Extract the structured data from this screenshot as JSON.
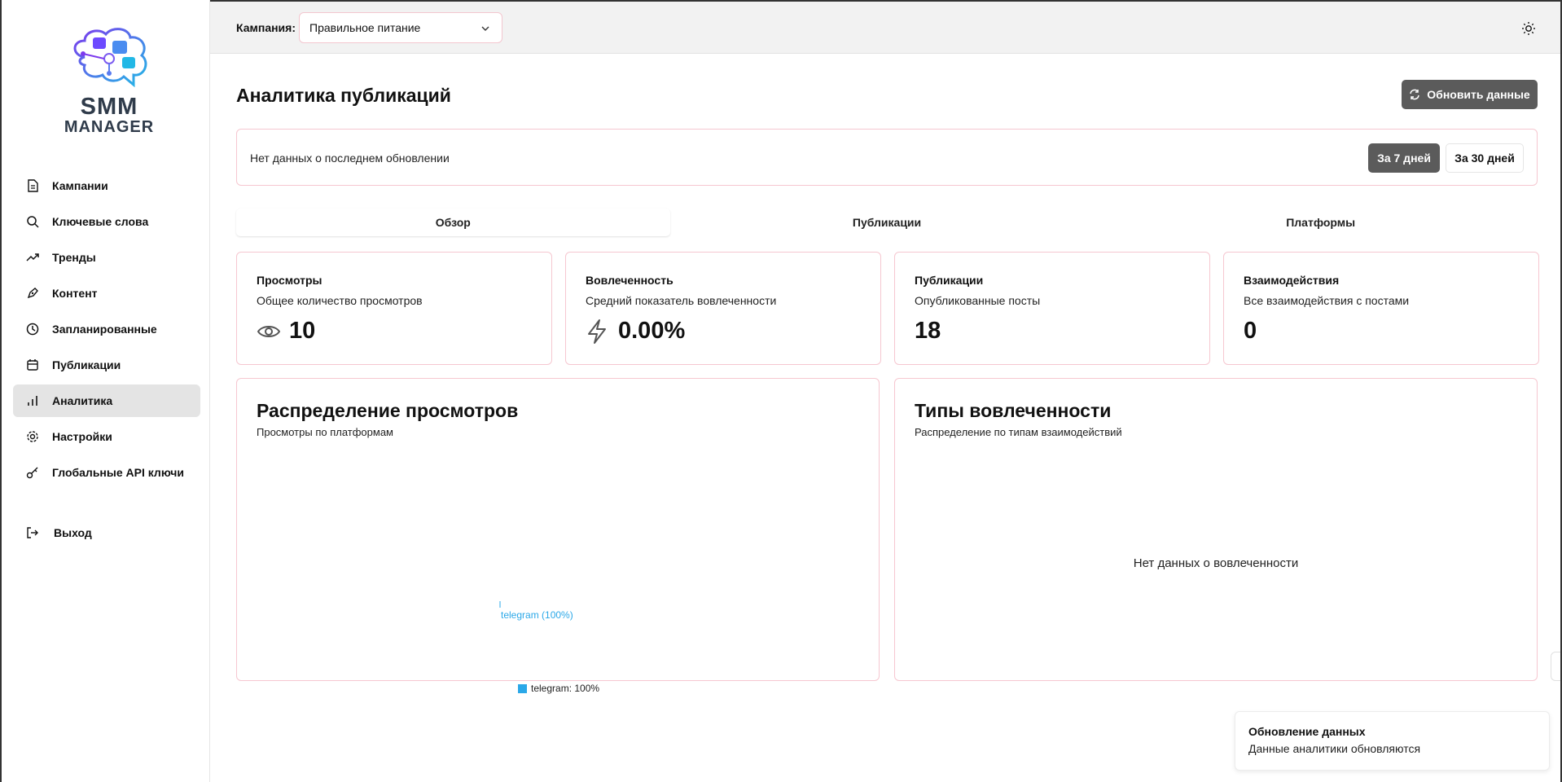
{
  "brand": {
    "line1": "SMM",
    "line2": "MANAGER"
  },
  "sidebar": {
    "items": [
      {
        "label": "Кампании",
        "icon": "file-icon"
      },
      {
        "label": "Ключевые слова",
        "icon": "search-icon"
      },
      {
        "label": "Тренды",
        "icon": "trending-icon"
      },
      {
        "label": "Контент",
        "icon": "pen-icon"
      },
      {
        "label": "Запланированные",
        "icon": "clock-icon"
      },
      {
        "label": "Публикации",
        "icon": "calendar-icon"
      },
      {
        "label": "Аналитика",
        "icon": "bar-chart-icon",
        "active": true
      },
      {
        "label": "Настройки",
        "icon": "gear-icon"
      },
      {
        "label": "Глобальные API ключи",
        "icon": "key-icon"
      }
    ],
    "logout": "Выход"
  },
  "header": {
    "campaign_label": "Кампания:",
    "campaign_value": "Правильное питание"
  },
  "page": {
    "title": "Аналитика публикаций",
    "refresh_label": "Обновить данные",
    "status_text": "Нет данных о последнем обновлении",
    "range_7": "За 7 дней",
    "range_30": "За 30 дней"
  },
  "tabs": [
    {
      "label": "Обзор",
      "active": true
    },
    {
      "label": "Публикации"
    },
    {
      "label": "Платформы"
    }
  ],
  "stats": [
    {
      "title": "Просмотры",
      "subtitle": "Общее количество просмотров",
      "value": "10",
      "icon": "eye-icon"
    },
    {
      "title": "Вовлеченность",
      "subtitle": "Средний показатель вовлеченности",
      "value": "0.00%",
      "icon": "lightning-icon"
    },
    {
      "title": "Публикации",
      "subtitle": "Опубликованные посты",
      "value": "18"
    },
    {
      "title": "Взаимодействия",
      "subtitle": "Все взаимодействия с постами",
      "value": "0"
    }
  ],
  "views_chart": {
    "title": "Распределение просмотров",
    "subtitle": "Просмотры по платформам"
  },
  "engagement_chart": {
    "title": "Типы вовлеченности",
    "subtitle": "Распределение по типам взаимодействий",
    "empty": "Нет данных о вовлеченности"
  },
  "chart_data": {
    "type": "pie",
    "categories": [
      "telegram"
    ],
    "values": [
      100
    ],
    "slice_labels": [
      "telegram (100%)"
    ],
    "legend": [
      "telegram: 100%"
    ],
    "colors": [
      "#2ba8e8"
    ],
    "legend_position": "bottom"
  },
  "toast": {
    "title": "Обновление данных",
    "text": "Данные аналитики обновляются"
  },
  "colors": {
    "accent_border": "#f6c7d0",
    "button_dark": "#5b5b5b",
    "telegram": "#2ba8e8"
  }
}
